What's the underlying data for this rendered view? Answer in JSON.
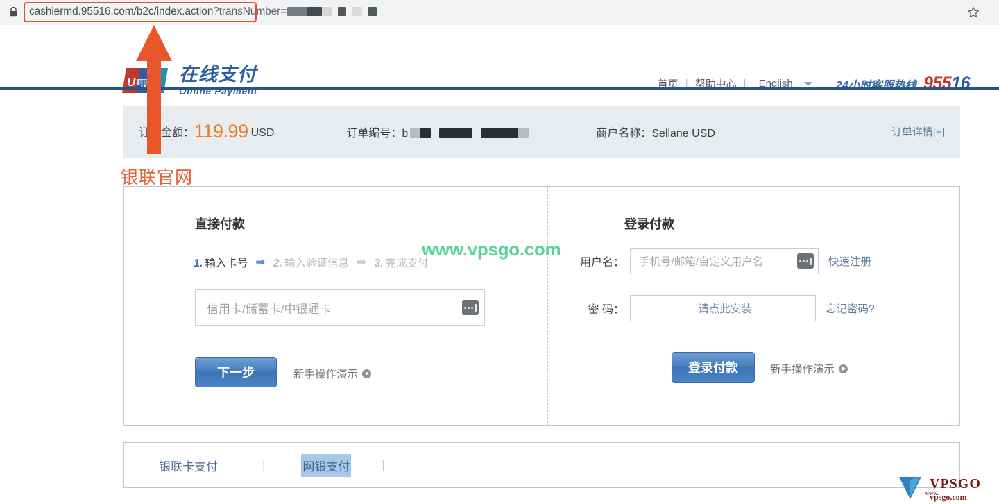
{
  "browser": {
    "lock_icon": "lock-icon",
    "url_highlighted": "cashiermd.95516.com/b2c/index.action",
    "url_rest": "?transNumber=",
    "url_redacted": true,
    "bookmark_icon": "star-icon"
  },
  "header": {
    "logo_icon": "unionpay-logo-icon",
    "logo_title_cn": "在线支付",
    "logo_title_en": "Online  Payment",
    "nav": [
      {
        "label": "首页",
        "name": "nav-home"
      },
      {
        "label": "帮助中心",
        "name": "nav-help-center"
      },
      {
        "label": "English",
        "name": "nav-language"
      }
    ],
    "nav_separator": "|",
    "language_caret_icon": "chevron-down-icon",
    "hotline_label": "24小时客服热线",
    "hotline_number_red": "955",
    "hotline_number_blue": "16"
  },
  "order": {
    "amount_label": "订单金额：",
    "amount_value": "119.99",
    "amount_currency": "USD",
    "number_label": "订单编号：",
    "number_prefix": "b",
    "merchant_label": "商户名称：",
    "merchant_value": "Sellane USD",
    "detail_link": "订单详情[+]"
  },
  "direct_payment": {
    "title": "直接付款",
    "steps": [
      {
        "num": "1.",
        "label": "输入卡号",
        "active": true
      },
      {
        "num": "2.",
        "label": "输入验证信息",
        "active": false
      },
      {
        "num": "3.",
        "label": "完成支付",
        "active": false
      }
    ],
    "step_arrow": "➡",
    "card_placeholder": "信用卡/储蓄卡/中银通卡",
    "keyboard_icon": "soft-keyboard-icon",
    "next_button": "下一步",
    "demo_link": "新手操作演示",
    "play_icon": "play-circle-icon"
  },
  "login_payment": {
    "title": "登录付款",
    "username_label": "用户名：",
    "username_placeholder": "手机号/邮箱/自定义用户名",
    "keyboard_icon": "soft-keyboard-icon",
    "register_link": "快速注册",
    "password_label": "密  码：",
    "password_install_text": "请点此安装",
    "forgot_link": "忘记密码?",
    "login_button": "登录付款",
    "demo_link": "新手操作演示",
    "play_icon": "play-circle-icon"
  },
  "payment_tabs": {
    "items": [
      {
        "label": "银联卡支付",
        "selected": false
      },
      {
        "label": "网银支付",
        "selected": true
      }
    ],
    "separator": "|"
  },
  "annotations": {
    "arrow_icon": "up-arrow-annotation-icon",
    "arrow_label": "银联官网",
    "watermark_text": "www.vpsgo.com",
    "watermark_logo": "vpsgo-logo-icon",
    "watermark_logo_name": "VPSGO",
    "watermark_logo_url": "vpsgo.com",
    "watermark_logo_www": "www."
  },
  "colors": {
    "accent_blue": "#3d6fb4",
    "amount_orange": "#f07c22",
    "annotation_orange": "#e06236",
    "watermark_green": "#57d39a",
    "header_rule": "#26538d",
    "tab_selected_bg": "#a8c8ea"
  }
}
